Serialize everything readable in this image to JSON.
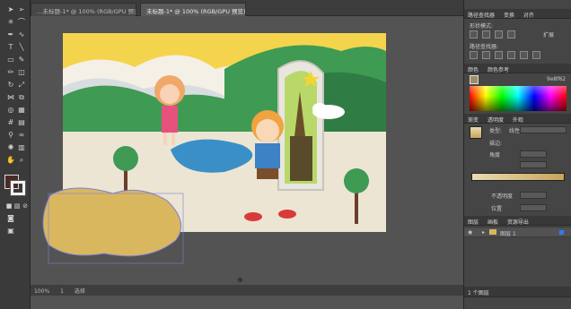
{
  "tabs": [
    {
      "label": "…未标题-1* @ 100% (RGB/GPU 预览)"
    },
    {
      "label": "未标题-1* @ 100% (RGB/GPU 预览)"
    }
  ],
  "status": {
    "zoom": "100%",
    "page": "1",
    "mode": "选择"
  },
  "panels": {
    "pathfinder": {
      "header": "路径查找器",
      "tab2": "变换",
      "tab3": "对齐",
      "shape_modes": "形状模式:",
      "pathfinders": "路径查找器:",
      "expand": "扩展"
    },
    "color": {
      "header": "颜色",
      "tab2": "颜色参考",
      "hex": "9e8f62"
    },
    "gradient": {
      "header": "渐变",
      "tab2": "透明度",
      "tab3": "外观",
      "type_label": "类型:",
      "type_value": "线性",
      "stroke_label": "描边:",
      "angle_label": "角度",
      "opacity_label": "不透明度",
      "location_label": "位置"
    },
    "layers": {
      "header": "图层",
      "tab2": "画板",
      "tab3": "资源导出",
      "layer_name": "图层 1",
      "footer": "1 个图层"
    }
  },
  "colors": {
    "fill": "#4a2b26",
    "accent": "#2c7df0"
  }
}
